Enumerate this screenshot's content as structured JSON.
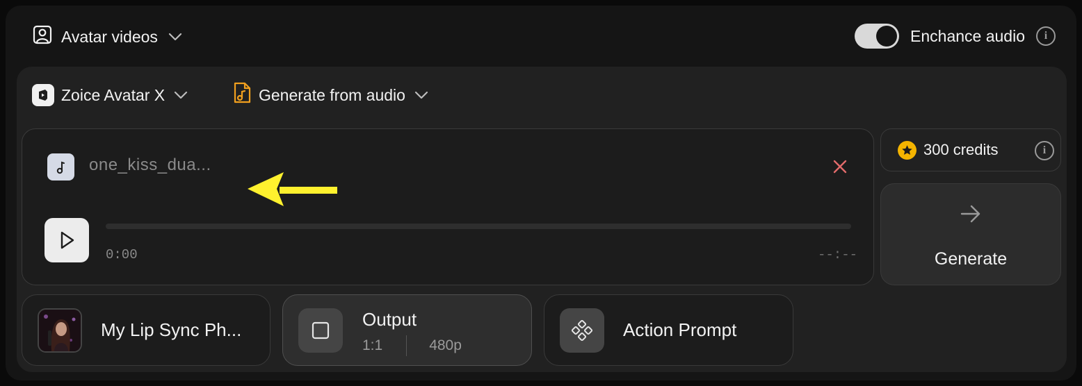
{
  "header": {
    "mode_label": "Avatar videos",
    "enhance_label": "Enchance audio",
    "enhance_on": true
  },
  "selectors": {
    "model_label": "Zoice Avatar X",
    "source_label": "Generate from audio"
  },
  "audio": {
    "file_name": "one_kiss_dua...",
    "current_time": "0:00",
    "total_time": "--:--",
    "progress": 0
  },
  "credits": {
    "amount": "300",
    "unit": "credits"
  },
  "generate": {
    "label": "Generate"
  },
  "options": {
    "lip_sync_label": "My Lip Sync Ph...",
    "output_title": "Output",
    "output_ratio": "1:1",
    "output_resolution": "480p",
    "action_label": "Action Prompt"
  },
  "colors": {
    "accent_yellow": "#f4b400",
    "annotation_arrow": "#fff12e",
    "close_red": "#e26b6b",
    "source_icon": "#f2a01e"
  },
  "icons": {
    "mode": "person-square-icon",
    "model": "zoice-logo-icon",
    "source": "audio-file-icon",
    "note": "music-note-icon",
    "close": "close-icon",
    "play": "play-icon",
    "credits": "star-icon",
    "generate": "arrow-right-icon",
    "output": "square-ratio-icon",
    "action": "diamond-dots-icon"
  }
}
